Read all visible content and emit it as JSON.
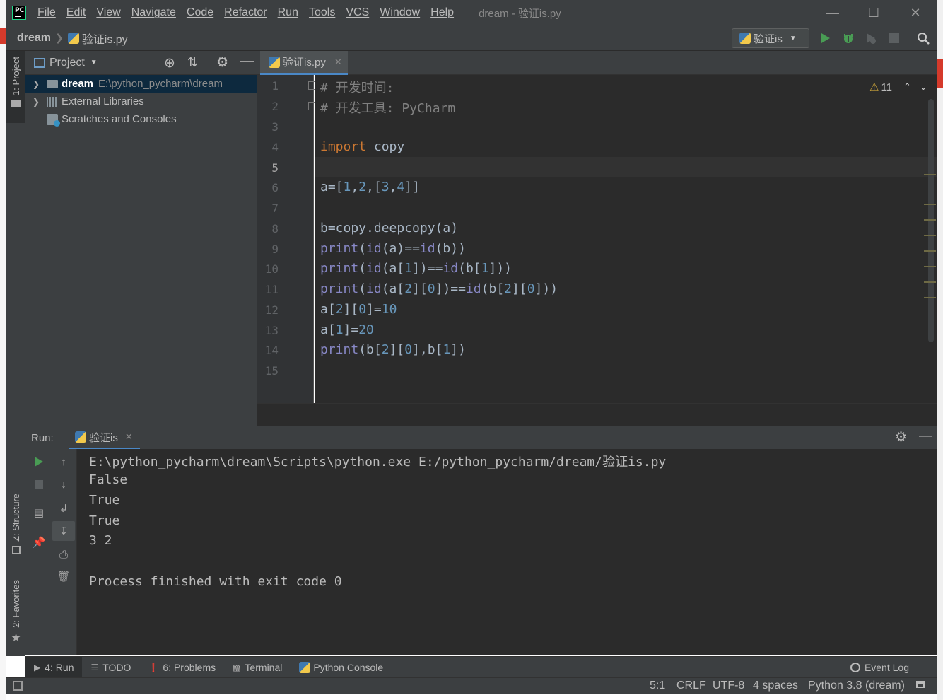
{
  "titlebar": {
    "logo": "PC",
    "menu": [
      "File",
      "Edit",
      "View",
      "Navigate",
      "Code",
      "Refactor",
      "Run",
      "Tools",
      "VCS",
      "Window",
      "Help"
    ],
    "window_title": "dream - 验证is.py",
    "controls": [
      "minimize-icon",
      "maximize-icon",
      "close-icon"
    ]
  },
  "navbar": {
    "project": "dream",
    "file": "验证is.py",
    "run_config": "验证is",
    "icons": [
      "run-icon",
      "debug-icon",
      "coverage-icon",
      "stop-icon",
      "search-icon"
    ]
  },
  "left_strip": {
    "project_tab": "1: Project",
    "structure_tab": "Z: Structure",
    "favorites_tab": "2: Favorites"
  },
  "project_panel": {
    "title": "Project",
    "tree": [
      {
        "name": "dream",
        "path": "E:\\python_pycharm\\dream"
      },
      {
        "name": "External Libraries"
      },
      {
        "name": "Scratches and Consoles"
      }
    ]
  },
  "editor": {
    "tab": "验证is.py",
    "warnings_count": "11",
    "line_numbers": [
      "1",
      "2",
      "3",
      "4",
      "5",
      "6",
      "7",
      "8",
      "9",
      "10",
      "11",
      "12",
      "13",
      "14",
      "15"
    ],
    "code_lines": [
      "# 开发时间:",
      "# 开发工具: PyCharm",
      "",
      "import copy",
      "",
      "a=[1,2,[3,4]]",
      "",
      "b=copy.deepcopy(a)",
      "print(id(a)==id(b))",
      "print(id(a[1])==id(b[1]))",
      "print(id(a[2][0])==id(b[2][0]))",
      "a[2][0]=10",
      "a[1]=20",
      "print(b[2][0],b[1])",
      ""
    ]
  },
  "run": {
    "label": "Run:",
    "tab": "验证is",
    "output": [
      "E:\\python_pycharm\\dream\\Scripts\\python.exe E:/python_pycharm/dream/验证is.py",
      "False",
      "True",
      "True",
      "3 2",
      "",
      "Process finished with exit code 0"
    ]
  },
  "tool_tabs": {
    "run": "4: Run",
    "todo": "TODO",
    "problems": "6: Problems",
    "terminal": "Terminal",
    "python_console": "Python Console",
    "event_log": "Event Log"
  },
  "statusbar": {
    "position": "5:1",
    "line_sep": "CRLF",
    "encoding": "UTF-8",
    "indent": "4 spaces",
    "interpreter": "Python 3.8 (dream)"
  },
  "colors": {
    "accent": "#4a88c7",
    "run_green": "#499c54",
    "keyword": "#cc7832",
    "number": "#6897bb",
    "builtin": "#8888c6",
    "comment": "#808080"
  }
}
